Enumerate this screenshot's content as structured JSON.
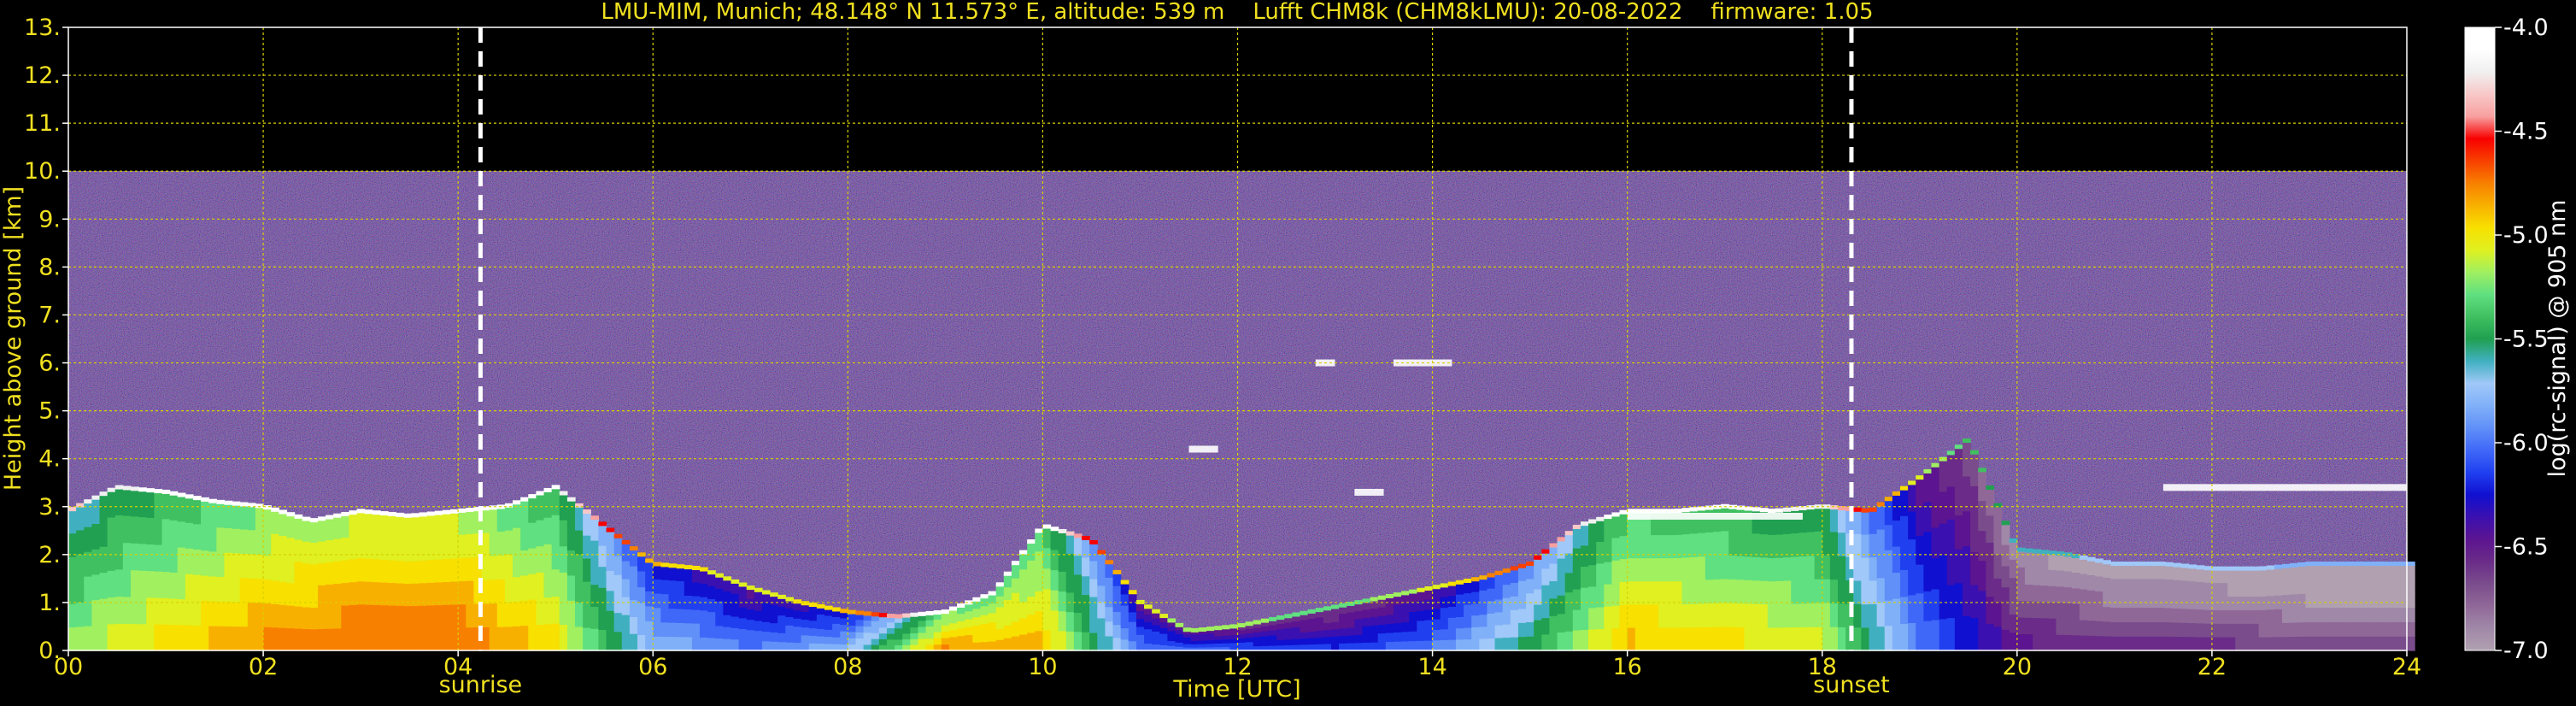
{
  "chart_data": {
    "type": "heatmap",
    "title": "LMU-MIM, Munich; 48.148° N 11.573° E, altitude: 539 m    Lufft CHM8k (CHM8kLMU): 20-08-2022    firmware: 1.05",
    "xlabel": "Time [UTC]",
    "ylabel": "Height above ground [km]",
    "xlim": [
      0,
      24
    ],
    "ylim": [
      0,
      13
    ],
    "x_ticks": [
      "00",
      "02",
      "04",
      "06",
      "08",
      "10",
      "12",
      "14",
      "16",
      "18",
      "20",
      "22",
      "24"
    ],
    "y_ticks": [
      "0.",
      "1.",
      "2.",
      "3.",
      "4.",
      "5.",
      "6.",
      "7.",
      "8.",
      "9.",
      "10.",
      "11.",
      "12.",
      "13."
    ],
    "grid": true,
    "grid_color": "#d8d000",
    "data_ceiling_km": 10,
    "markers": [
      {
        "label": "sunrise",
        "time_h": 4.23
      },
      {
        "label": "sunset",
        "time_h": 18.3
      }
    ],
    "colorbar": {
      "label": "log(rc-signal) @ 905 nm",
      "min": -7.0,
      "max": -4.0,
      "ticks": [
        "-4.0",
        "-4.5",
        "-5.0",
        "-5.5",
        "-6.0",
        "-6.5",
        "-7.0"
      ],
      "colors": [
        "#b0a0b0",
        "#a088a8",
        "#906898",
        "#7a4c8c",
        "#6a2c88",
        "#5c1490",
        "#3a10b0",
        "#1010d0",
        "#2040f0",
        "#4068f8",
        "#6090f8",
        "#80b0f8",
        "#a0c8f8",
        "#40b0c0",
        "#20a050",
        "#40c060",
        "#60e080",
        "#a0f060",
        "#e0f020",
        "#f8e000",
        "#f8b000",
        "#f88000",
        "#f84000",
        "#f80000",
        "#f8a0a0",
        "#f8c8c8",
        "#f0f0f0",
        "#ffffff",
        "#ffffff"
      ]
    },
    "boundary_layer_top_km": [
      [
        0,
        2.9
      ],
      [
        0.5,
        3.4
      ],
      [
        1,
        3.3
      ],
      [
        1.5,
        3.1
      ],
      [
        2,
        3.0
      ],
      [
        2.5,
        2.7
      ],
      [
        3,
        2.9
      ],
      [
        3.5,
        2.8
      ],
      [
        4,
        2.9
      ],
      [
        4.5,
        3.0
      ],
      [
        5,
        3.4
      ],
      [
        5.5,
        2.6
      ],
      [
        6,
        1.8
      ],
      [
        6.5,
        1.7
      ],
      [
        7,
        1.3
      ],
      [
        7.5,
        1.0
      ],
      [
        8,
        0.8
      ],
      [
        8.5,
        0.7
      ],
      [
        9,
        0.8
      ],
      [
        9.5,
        1.2
      ],
      [
        10,
        2.6
      ],
      [
        10.5,
        2.3
      ],
      [
        11,
        1.0
      ],
      [
        11.5,
        0.4
      ],
      [
        12,
        0.5
      ],
      [
        12.5,
        0.7
      ],
      [
        13,
        0.9
      ],
      [
        13.5,
        1.1
      ],
      [
        14,
        1.3
      ],
      [
        14.5,
        1.5
      ],
      [
        15,
        1.8
      ],
      [
        15.5,
        2.6
      ],
      [
        16,
        2.9
      ],
      [
        16.5,
        2.9
      ],
      [
        17,
        3.0
      ],
      [
        17.5,
        2.9
      ],
      [
        18,
        3.0
      ],
      [
        18.5,
        2.9
      ],
      [
        19,
        3.6
      ],
      [
        19.5,
        4.4
      ],
      [
        20,
        2.1
      ],
      [
        20.5,
        2.0
      ],
      [
        21,
        1.8
      ],
      [
        21.5,
        1.8
      ],
      [
        22,
        1.7
      ],
      [
        22.5,
        1.7
      ],
      [
        23,
        1.8
      ],
      [
        23.5,
        1.8
      ],
      [
        24,
        1.8
      ]
    ],
    "boundary_layer_log_signal": [
      [
        0,
        -5.2
      ],
      [
        1,
        -5.0
      ],
      [
        2,
        -4.8
      ],
      [
        3,
        -4.7
      ],
      [
        4,
        -4.7
      ],
      [
        5,
        -5.0
      ],
      [
        6,
        -5.8
      ],
      [
        7,
        -6.0
      ],
      [
        8,
        -5.8
      ],
      [
        9,
        -4.8
      ],
      [
        10,
        -4.9
      ],
      [
        11,
        -6.0
      ],
      [
        12,
        -6.1
      ],
      [
        13,
        -6.2
      ],
      [
        14,
        -6.0
      ],
      [
        15,
        -5.5
      ],
      [
        16,
        -4.9
      ],
      [
        17,
        -5.0
      ],
      [
        18,
        -5.1
      ],
      [
        19,
        -6.0
      ],
      [
        20,
        -6.5
      ],
      [
        21,
        -6.6
      ],
      [
        22,
        -6.6
      ],
      [
        23,
        -6.7
      ],
      [
        24,
        -6.7
      ]
    ],
    "elevated_layers": [
      {
        "t0": 13.2,
        "t1": 13.5,
        "height_km": 3.3
      },
      {
        "t0": 16.0,
        "t1": 17.8,
        "height_km": 2.8
      },
      {
        "t0": 21.5,
        "t1": 24.0,
        "height_km": 3.4
      },
      {
        "t0": 12.8,
        "t1": 13.0,
        "height_km": 6.0
      },
      {
        "t0": 13.6,
        "t1": 14.2,
        "height_km": 6.0
      },
      {
        "t0": 11.5,
        "t1": 11.8,
        "height_km": 4.2
      }
    ]
  }
}
